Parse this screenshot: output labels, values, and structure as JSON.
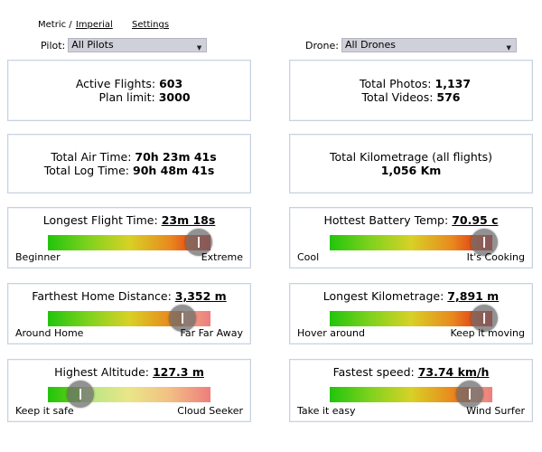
{
  "top_links": {
    "metric": "Metric",
    "sep": "/",
    "imperial": "Imperial",
    "settings": "Settings"
  },
  "filters": {
    "pilot": {
      "label": "Pilot:",
      "value": "All Pilots"
    },
    "drone": {
      "label": "Drone:",
      "value": "All Drones"
    }
  },
  "stats": {
    "active_flights_label": "Active Flights:",
    "active_flights": "603",
    "plan_limit_label": "Plan limit:",
    "plan_limit": "3000",
    "total_photos_label": "Total Photos:",
    "total_photos": "1,137",
    "total_videos_label": "Total Videos:",
    "total_videos": "576",
    "air_time_label": "Total Air Time:",
    "air_time": "70h 23m 41s",
    "log_time_label": "Total Log Time:",
    "log_time": "90h 48m 41s",
    "km_label": "Total Kilometrage (all flights)",
    "km_value": "1,056 Km"
  },
  "gauges": {
    "longest_flight": {
      "label": "Longest Flight Time:",
      "value": "23m 18s",
      "min_label": "Beginner",
      "max_label": "Extreme",
      "level": 0.93
    },
    "hottest_battery": {
      "label": "Hottest Battery Temp:",
      "value": "70.95 c",
      "min_label": "Cool",
      "max_label": "It's Cooking",
      "level": 0.95
    },
    "farthest_home": {
      "label": "Farthest Home Distance:",
      "value": "3,352 m",
      "min_label": "Around Home",
      "max_label": "Far Far Away",
      "level": 0.83
    },
    "longest_km": {
      "label": "Longest Kilometrage:",
      "value": "7,891 m",
      "min_label": "Hover around",
      "max_label": "Keep it moving",
      "level": 0.95
    },
    "highest_altitude": {
      "label": "Highest Altitude:",
      "value": "127.3 m",
      "min_label": "Keep it safe",
      "max_label": "Cloud Seeker",
      "level": 0.2
    },
    "fastest_speed": {
      "label": "Fastest speed:",
      "value": "73.74 km/h",
      "min_label": "Take it easy",
      "max_label": "Wind Surfer",
      "level": 0.86
    }
  },
  "colors": {
    "border": "#c7d2e0",
    "select_bg": "#d0d0da"
  },
  "icons": {
    "dropdown": "chevron-down-icon"
  }
}
